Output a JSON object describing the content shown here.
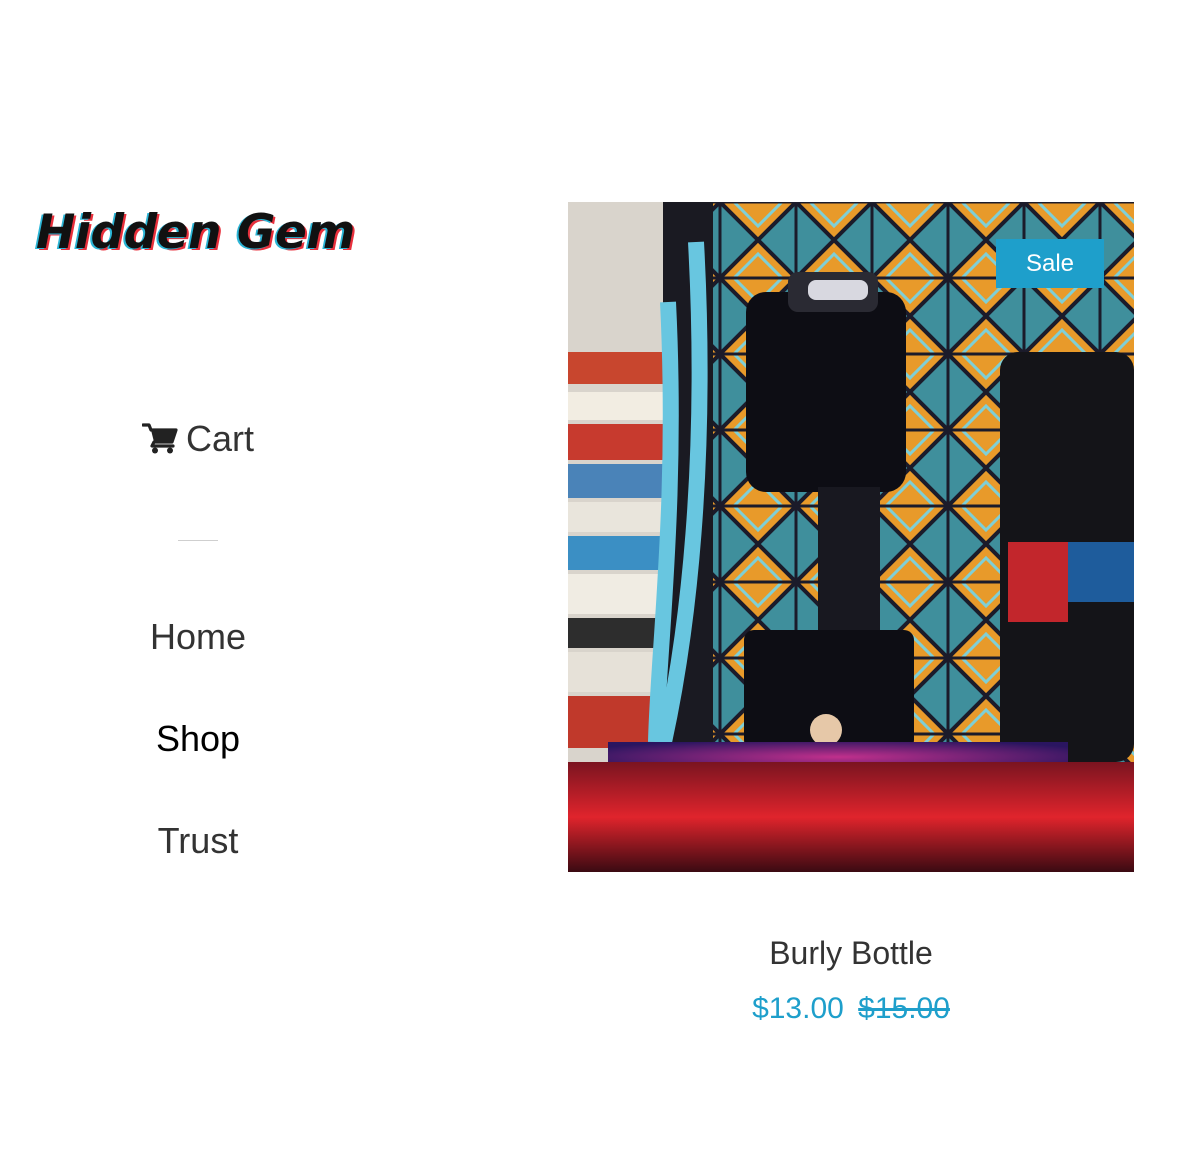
{
  "store": {
    "logo_text": "Hidden Gem"
  },
  "sidebar": {
    "cart_label": "Cart",
    "cart_icon": "shopping-cart-icon",
    "nav": [
      {
        "label": "Home"
      },
      {
        "label": "Shop",
        "active": true
      },
      {
        "label": "Trust"
      }
    ]
  },
  "product": {
    "badge": "Sale",
    "title": "Burly Bottle",
    "price": "$13.00",
    "compare_at_price": "$15.00",
    "accent_color": "#1e9fcb"
  }
}
